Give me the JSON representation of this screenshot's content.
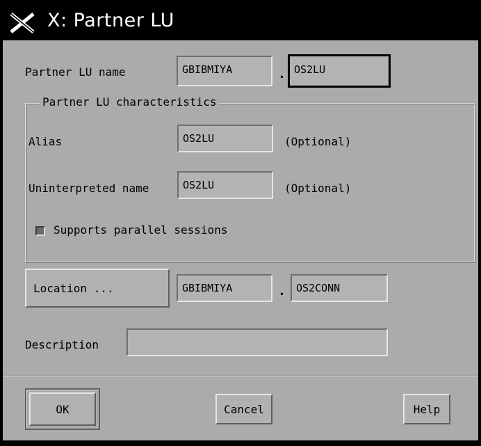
{
  "window": {
    "title": "X: Partner LU"
  },
  "partner_lu": {
    "label": "Partner LU name",
    "network_value": "GBIBMIYA",
    "separator": ".",
    "lu_value": "OS2LU"
  },
  "characteristics": {
    "title": "Partner LU characteristics",
    "alias_label": "Alias",
    "alias_value": "OS2LU",
    "alias_optional": "(Optional)",
    "uninterpreted_label": "Uninterpreted name",
    "uninterpreted_value": "OS2LU",
    "uninterpreted_optional": "(Optional)",
    "parallel_label": "Supports parallel sessions",
    "parallel_checked": true
  },
  "location": {
    "button_label": "Location ...",
    "network_value": "GBIBMIYA",
    "separator": ".",
    "connection_value": "OS2CONN"
  },
  "description": {
    "label": "Description",
    "value": ""
  },
  "buttons": {
    "ok": "OK",
    "cancel": "Cancel",
    "help": "Help"
  },
  "icons": {
    "window_menu": "x-window-icon",
    "checkbox": "checkbox-icon"
  },
  "colors": {
    "background": "#ababab",
    "title_bar": "#000000",
    "title_text": "#ffffff"
  }
}
